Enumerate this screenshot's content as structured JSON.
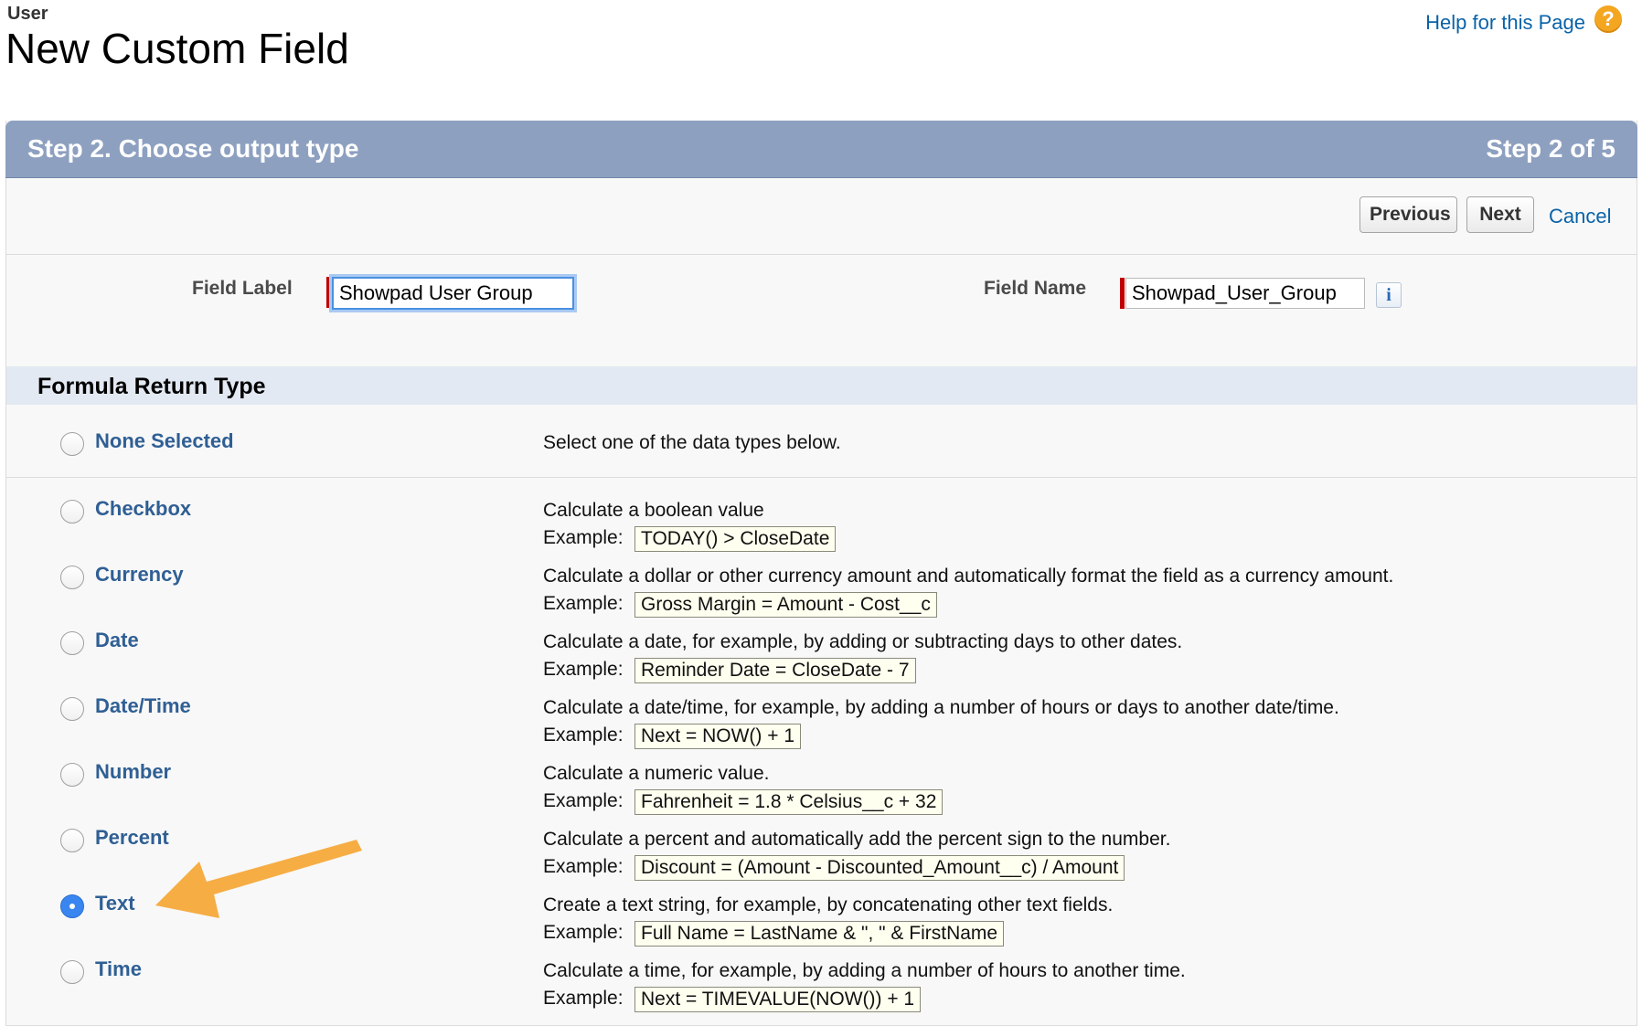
{
  "page": {
    "object_name": "User",
    "title": "New Custom Field",
    "help_link": "Help for this Page",
    "help_icon": "question-icon"
  },
  "step": {
    "title": "Step 2. Choose output type",
    "count": "Step 2 of 5"
  },
  "buttons": {
    "previous": "Previous",
    "next": "Next",
    "cancel": "Cancel"
  },
  "fields": {
    "label_caption": "Field Label",
    "label_value": "Showpad User Group",
    "name_caption": "Field Name",
    "name_value": "Showpad_User_Group",
    "info_icon": "i"
  },
  "section": {
    "title": "Formula Return Type"
  },
  "return_types": [
    {
      "label": "None Selected",
      "description": "Select one of the data types below.",
      "example": "",
      "checked": false
    },
    {
      "label": "Checkbox",
      "description": "Calculate a boolean value",
      "example": "TODAY() > CloseDate",
      "checked": false
    },
    {
      "label": "Currency",
      "description": "Calculate a dollar or other currency amount and automatically format the field as a currency amount.",
      "example": "Gross Margin = Amount - Cost__c",
      "checked": false
    },
    {
      "label": "Date",
      "description": "Calculate a date, for example, by adding or subtracting days to other dates.",
      "example": "Reminder Date = CloseDate - 7",
      "checked": false
    },
    {
      "label": "Date/Time",
      "description": "Calculate a date/time, for example, by adding a number of hours or days to another date/time.",
      "example": "Next = NOW() + 1",
      "checked": false
    },
    {
      "label": "Number",
      "description": "Calculate a numeric value.",
      "example": "Fahrenheit = 1.8 * Celsius__c + 32",
      "checked": false
    },
    {
      "label": "Percent",
      "description": "Calculate a percent and automatically add the percent sign to the number.",
      "example": "Discount = (Amount - Discounted_Amount__c) / Amount",
      "checked": false
    },
    {
      "label": "Text",
      "description": "Create a text string, for example, by concatenating other text fields.",
      "example": "Full Name = LastName & \", \" & FirstName",
      "checked": true
    },
    {
      "label": "Time",
      "description": "Calculate a time, for example, by adding a number of hours to another time.",
      "example": "Next = TIMEVALUE(NOW()) + 1",
      "checked": false
    }
  ],
  "example_prefix": "Example:",
  "colors": {
    "header_bg": "#8da0c0",
    "link": "#0a63a8",
    "type_label": "#2f5f94",
    "required_marker": "#c00000",
    "annotation_arrow": "#f5a93a"
  }
}
